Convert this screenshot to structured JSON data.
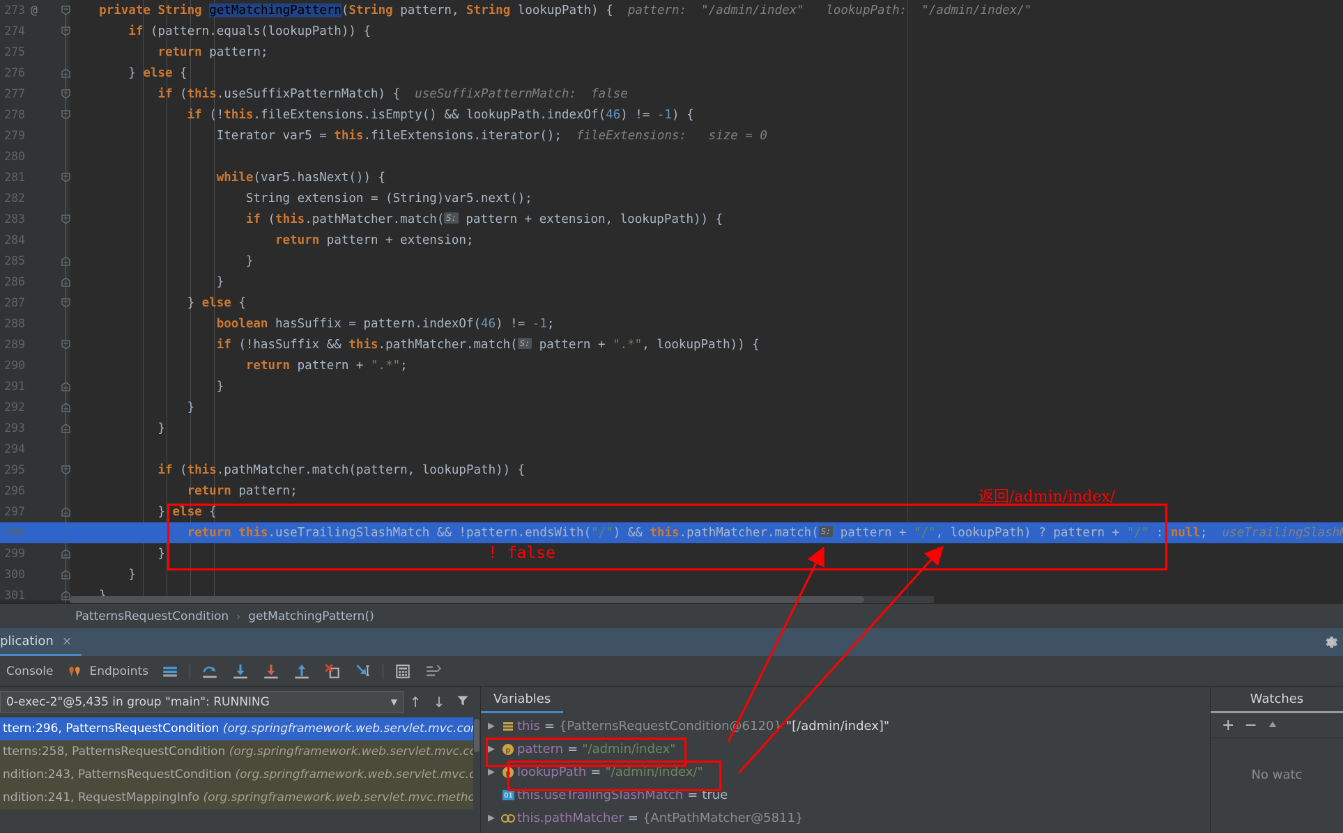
{
  "editor": {
    "lines": [
      {
        "num": "273",
        "at": "@",
        "fold": "start",
        "tokens": [
          {
            "t": "    ",
            "c": "id"
          },
          {
            "t": "private ",
            "c": "kwb"
          },
          {
            "t": "String ",
            "c": "kwb"
          },
          {
            "t": "getMatchingPattern",
            "c": "sel-ident"
          },
          {
            "t": "(",
            "c": "id"
          },
          {
            "t": "String ",
            "c": "kwb"
          },
          {
            "t": "pattern, ",
            "c": "id"
          },
          {
            "t": "String ",
            "c": "kwb"
          },
          {
            "t": "lookupPath) {",
            "c": "id"
          }
        ],
        "hint": "  pattern:  \"/admin/index\"   lookupPath:  \"/admin/index/\""
      },
      {
        "num": "274",
        "fold": "start",
        "tokens": [
          {
            "t": "        ",
            "c": "id"
          },
          {
            "t": "if ",
            "c": "kwb"
          },
          {
            "t": "(pattern.equals(lookupPath)) {",
            "c": "id"
          }
        ]
      },
      {
        "num": "275",
        "tokens": [
          {
            "t": "            ",
            "c": "id"
          },
          {
            "t": "return ",
            "c": "kwb"
          },
          {
            "t": "pattern;",
            "c": "id"
          }
        ]
      },
      {
        "num": "276",
        "fold": "end",
        "tokens": [
          {
            "t": "        } ",
            "c": "id"
          },
          {
            "t": "else ",
            "c": "kwb"
          },
          {
            "t": "{",
            "c": "id"
          }
        ]
      },
      {
        "num": "277",
        "fold": "start",
        "tokens": [
          {
            "t": "            ",
            "c": "id"
          },
          {
            "t": "if ",
            "c": "kwb"
          },
          {
            "t": "(",
            "c": "id"
          },
          {
            "t": "this",
            "c": "kwb"
          },
          {
            "t": ".useSuffixPatternMatch) {",
            "c": "id"
          }
        ],
        "hint": "  useSuffixPatternMatch:  false"
      },
      {
        "num": "278",
        "fold": "start",
        "tokens": [
          {
            "t": "                ",
            "c": "id"
          },
          {
            "t": "if ",
            "c": "kwb"
          },
          {
            "t": "(!",
            "c": "id"
          },
          {
            "t": "this",
            "c": "kwb"
          },
          {
            "t": ".fileExtensions.isEmpty() && lookupPath.indexOf(",
            "c": "id"
          },
          {
            "t": "46",
            "c": "num"
          },
          {
            "t": ") != ",
            "c": "id"
          },
          {
            "t": "-1",
            "c": "num"
          },
          {
            "t": ") {",
            "c": "id"
          }
        ]
      },
      {
        "num": "279",
        "tokens": [
          {
            "t": "                    Iterator var5 = ",
            "c": "id"
          },
          {
            "t": "this",
            "c": "kwb"
          },
          {
            "t": ".fileExtensions.iterator();",
            "c": "id"
          }
        ],
        "hint": "  fileExtensions:   size = 0"
      },
      {
        "num": "280",
        "tokens": []
      },
      {
        "num": "281",
        "fold": "start",
        "tokens": [
          {
            "t": "                    ",
            "c": "id"
          },
          {
            "t": "while",
            "c": "kwb"
          },
          {
            "t": "(var5.hasNext()) {",
            "c": "id"
          }
        ]
      },
      {
        "num": "282",
        "tokens": [
          {
            "t": "                        String extension = (String)var5.next();",
            "c": "id"
          }
        ]
      },
      {
        "num": "283",
        "fold": "start",
        "tokens": [
          {
            "t": "                        ",
            "c": "id"
          },
          {
            "t": "if ",
            "c": "kwb"
          },
          {
            "t": "(",
            "c": "id"
          },
          {
            "t": "this",
            "c": "kwb"
          },
          {
            "t": ".pathMatcher.match(",
            "c": "id"
          },
          {
            "t": "S:",
            "c": "badge"
          },
          {
            "t": " pattern + extension, lookupPath)) {",
            "c": "id"
          }
        ]
      },
      {
        "num": "284",
        "tokens": [
          {
            "t": "                            ",
            "c": "id"
          },
          {
            "t": "return ",
            "c": "kwb"
          },
          {
            "t": "pattern + extension;",
            "c": "id"
          }
        ]
      },
      {
        "num": "285",
        "fold": "end",
        "tokens": [
          {
            "t": "                        }",
            "c": "id"
          }
        ]
      },
      {
        "num": "286",
        "fold": "end",
        "tokens": [
          {
            "t": "                    }",
            "c": "id"
          }
        ]
      },
      {
        "num": "287",
        "fold": "start",
        "tokens": [
          {
            "t": "                } ",
            "c": "id"
          },
          {
            "t": "else ",
            "c": "kwb"
          },
          {
            "t": "{",
            "c": "id"
          }
        ]
      },
      {
        "num": "288",
        "tokens": [
          {
            "t": "                    ",
            "c": "id"
          },
          {
            "t": "boolean ",
            "c": "kwb"
          },
          {
            "t": "hasSuffix = pattern.indexOf(",
            "c": "id"
          },
          {
            "t": "46",
            "c": "num"
          },
          {
            "t": ") != ",
            "c": "id"
          },
          {
            "t": "-1",
            "c": "num"
          },
          {
            "t": ";",
            "c": "id"
          }
        ]
      },
      {
        "num": "289",
        "fold": "start",
        "tokens": [
          {
            "t": "                    ",
            "c": "id"
          },
          {
            "t": "if ",
            "c": "kwb"
          },
          {
            "t": "(!hasSuffix && ",
            "c": "id"
          },
          {
            "t": "this",
            "c": "kwb"
          },
          {
            "t": ".pathMatcher.match(",
            "c": "id"
          },
          {
            "t": "S:",
            "c": "badge"
          },
          {
            "t": " pattern + ",
            "c": "id"
          },
          {
            "t": "\".*\"",
            "c": "str"
          },
          {
            "t": ", lookupPath)) {",
            "c": "id"
          }
        ]
      },
      {
        "num": "290",
        "tokens": [
          {
            "t": "                        ",
            "c": "id"
          },
          {
            "t": "return ",
            "c": "kwb"
          },
          {
            "t": "pattern + ",
            "c": "id"
          },
          {
            "t": "\".*\"",
            "c": "str"
          },
          {
            "t": ";",
            "c": "id"
          }
        ]
      },
      {
        "num": "291",
        "fold": "end",
        "tokens": [
          {
            "t": "                    }",
            "c": "id"
          }
        ]
      },
      {
        "num": "292",
        "fold": "end",
        "tokens": [
          {
            "t": "                }",
            "c": "id"
          }
        ]
      },
      {
        "num": "293",
        "fold": "end",
        "tokens": [
          {
            "t": "            }",
            "c": "id"
          }
        ]
      },
      {
        "num": "294",
        "tokens": []
      },
      {
        "num": "295",
        "fold": "start",
        "tokens": [
          {
            "t": "            ",
            "c": "id"
          },
          {
            "t": "if ",
            "c": "kwb"
          },
          {
            "t": "(",
            "c": "id"
          },
          {
            "t": "this",
            "c": "kwb"
          },
          {
            "t": ".pathMatcher.match(pattern, lookupPath)) {",
            "c": "id"
          }
        ]
      },
      {
        "num": "296",
        "tokens": [
          {
            "t": "                ",
            "c": "id"
          },
          {
            "t": "return ",
            "c": "kwb"
          },
          {
            "t": "pattern;",
            "c": "id"
          }
        ]
      },
      {
        "num": "297",
        "fold": "end",
        "tokens": [
          {
            "t": "            } ",
            "c": "id"
          },
          {
            "t": "else ",
            "c": "kwb"
          },
          {
            "t": "{",
            "c": "id"
          }
        ]
      },
      {
        "num": "298",
        "selected": true,
        "tokens": [
          {
            "t": "                ",
            "c": "id"
          },
          {
            "t": "return ",
            "c": "kwb"
          },
          {
            "t": "this",
            "c": "kwb"
          },
          {
            "t": ".useTrailingSlashMatch && !pattern.endsWith(",
            "c": "id"
          },
          {
            "t": "\"/\"",
            "c": "str"
          },
          {
            "t": ") && ",
            "c": "id"
          },
          {
            "t": "this",
            "c": "kwb"
          },
          {
            "t": ".pathMatcher.match(",
            "c": "id"
          },
          {
            "t": "S:",
            "c": "badge"
          },
          {
            "t": " pattern + ",
            "c": "id"
          },
          {
            "t": "\"/\"",
            "c": "str"
          },
          {
            "t": ", lookupPath) ? pattern + ",
            "c": "id"
          },
          {
            "t": "\"/\"",
            "c": "str"
          },
          {
            "t": " : ",
            "c": "id"
          },
          {
            "t": "null",
            "c": "kwb"
          },
          {
            "t": ";",
            "c": "id"
          }
        ],
        "hint": "  useTrailingSlashMatch: true"
      },
      {
        "num": "299",
        "fold": "end",
        "tokens": [
          {
            "t": "            }",
            "c": "id"
          }
        ]
      },
      {
        "num": "300",
        "fold": "end",
        "tokens": [
          {
            "t": "        }",
            "c": "id"
          }
        ]
      },
      {
        "num": "301",
        "fold": "end",
        "tokens": [
          {
            "t": "    }",
            "c": "id"
          }
        ]
      }
    ]
  },
  "breadcrumb": {
    "class_name": "PatternsRequestCondition",
    "separator": "›",
    "method_name": "getMatchingPattern()"
  },
  "debug": {
    "tab_label": "plication",
    "tab_close": "×",
    "settings_icon": "gear-icon",
    "toolbar": {
      "console_label": "Console",
      "endpoints_label": "Endpoints",
      "buttons": [
        "show-execution-point",
        "step-over",
        "step-into",
        "force-step-into",
        "step-out",
        "drop-frame",
        "run-to-cursor",
        "evaluate-expression",
        "layout-settings"
      ]
    },
    "frames": {
      "thread_label": "0-exec-2\"@5,435 in group \"main\": RUNNING",
      "combo_arrow": "▼",
      "up_icon": "↑",
      "down_icon": "↓",
      "filter_icon": "filter-icon",
      "items": [
        {
          "method": "ttern:296, PatternsRequestCondition",
          "pkg": "(org.springframework.web.servlet.mvc.cond",
          "state": "active"
        },
        {
          "method": "tterns:258, PatternsRequestCondition",
          "pkg": "(org.springframework.web.servlet.mvc.con",
          "state": "lib"
        },
        {
          "method": "ndition:243, PatternsRequestCondition",
          "pkg": "(org.springframework.web.servlet.mvc.co",
          "state": "lib"
        },
        {
          "method": "ndition:241, RequestMappingInfo",
          "pkg": "(org.springframework.web.servlet.mvc.metho",
          "state": "lib"
        }
      ]
    },
    "variables": {
      "tab_label": "Variables",
      "rows": [
        {
          "expandable": true,
          "icon": "object-icon",
          "name": "this",
          "eq": "=",
          "value": "{PatternsRequestCondition@6120}",
          "value2": "\"[/admin/index]\"",
          "vtype": "obj"
        },
        {
          "expandable": true,
          "icon": "param-icon",
          "name": "pattern",
          "eq": "=",
          "value": "\"/admin/index\"",
          "vtype": "str",
          "boxed": true
        },
        {
          "expandable": true,
          "icon": "param-icon",
          "name": "lookupPath",
          "eq": "=",
          "value": "\"/admin/index/\"",
          "vtype": "str",
          "boxed": true
        },
        {
          "expandable": false,
          "icon": "bool-icon",
          "name": "this.useTrailingSlashMatch",
          "eq": "=",
          "value": "true",
          "vtype": "kw"
        },
        {
          "expandable": true,
          "icon": "field-icon",
          "name": "this.pathMatcher",
          "eq": "=",
          "value": "{AntPathMatcher@5811}",
          "vtype": "obj"
        }
      ]
    },
    "watches": {
      "tab_label": "Watches",
      "add_icon": "+",
      "remove_icon": "−",
      "empty_text": "No watc"
    }
  },
  "annotations": {
    "return_note": "返回/admin/index/",
    "false_note": "! false",
    "accent_color": "#ff0000"
  }
}
